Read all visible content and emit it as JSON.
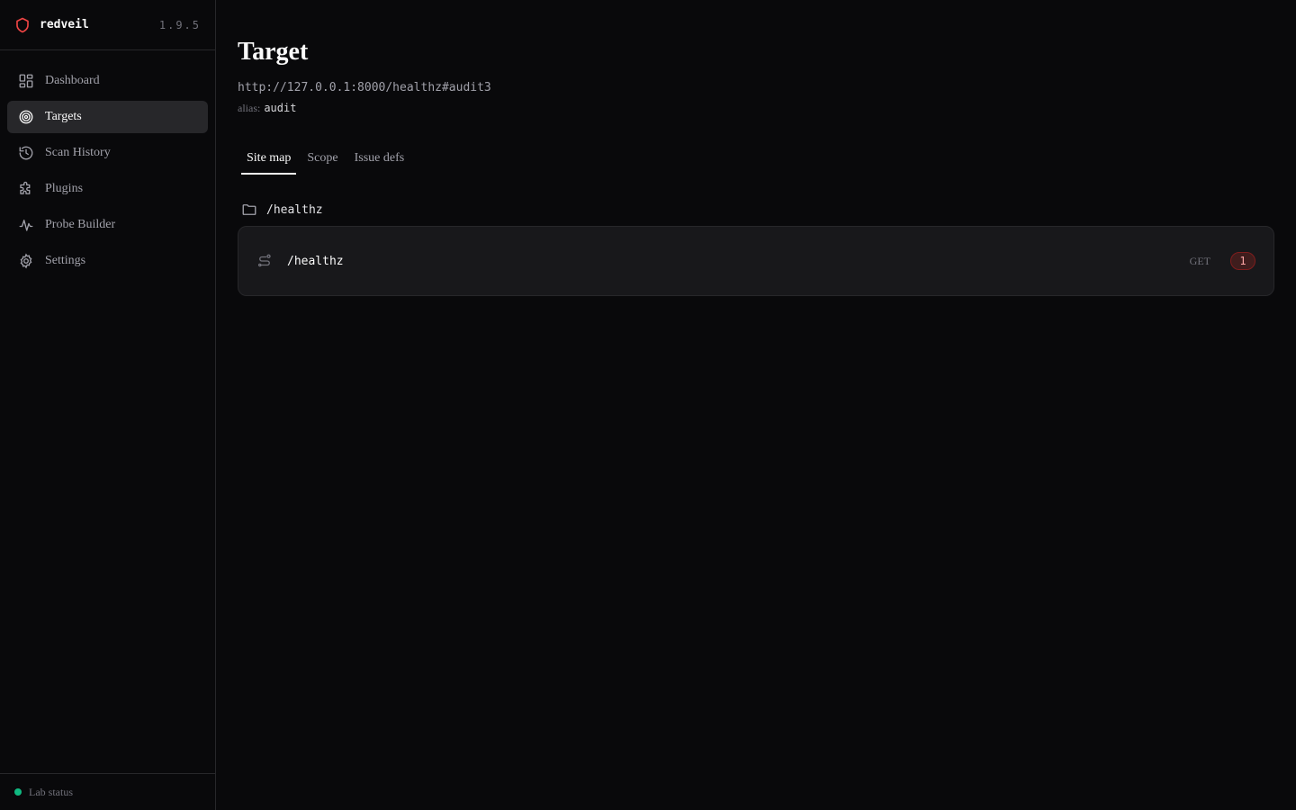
{
  "brand": {
    "name": "redveil",
    "version": "1.9.5",
    "logo_icon": "shield-icon",
    "accent": "#ef4444"
  },
  "sidebar": {
    "items": [
      {
        "label": "Dashboard",
        "icon": "grid-icon",
        "active": false
      },
      {
        "label": "Targets",
        "icon": "target-icon",
        "active": true
      },
      {
        "label": "Scan History",
        "icon": "history-icon",
        "active": false
      },
      {
        "label": "Plugins",
        "icon": "puzzle-icon",
        "active": false
      },
      {
        "label": "Probe Builder",
        "icon": "pulse-icon",
        "active": false
      },
      {
        "label": "Settings",
        "icon": "gear-icon",
        "active": false
      }
    ],
    "footer": {
      "status_label": "Lab status",
      "status_color": "#10b981"
    }
  },
  "main": {
    "title": "Target",
    "url": "http://127.0.0.1:8000/healthz#audit3",
    "alias_label": "alias:",
    "alias_value": "audit",
    "tabs": [
      {
        "label": "Site map",
        "active": true
      },
      {
        "label": "Scope",
        "active": false
      },
      {
        "label": "Issue defs",
        "active": false
      }
    ],
    "sitemap": {
      "folder": "/healthz",
      "endpoints": [
        {
          "path": "/healthz",
          "method": "GET",
          "count": "1"
        }
      ]
    }
  }
}
